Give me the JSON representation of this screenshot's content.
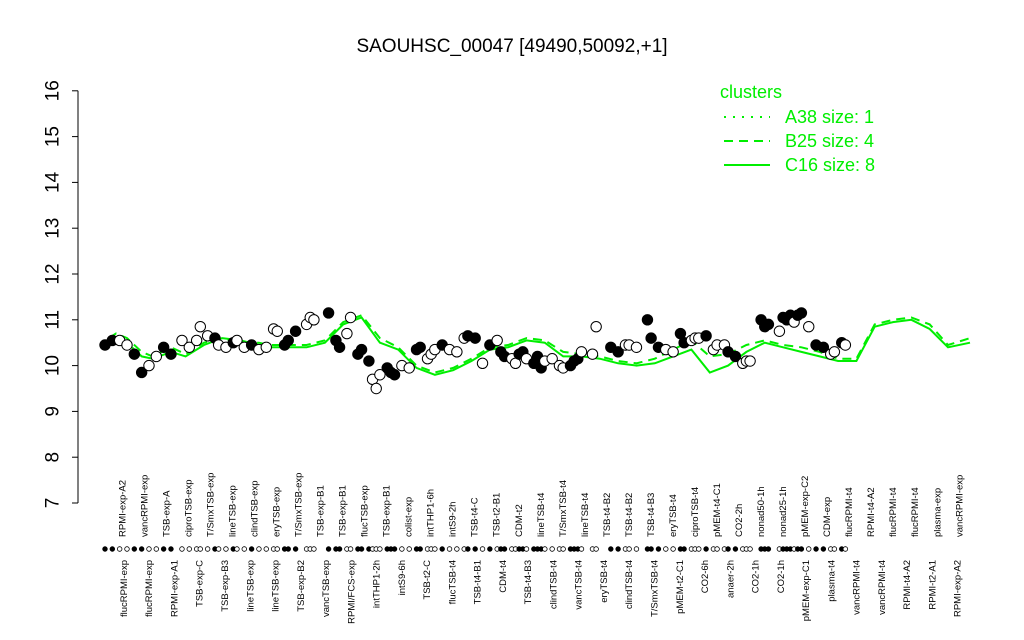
{
  "chart_data": {
    "type": "line",
    "title": "SAOUHSC_00047 [49490,50092,+1]",
    "xlabel": "",
    "ylabel": "",
    "ylim": [
      7,
      16
    ],
    "yticks": [
      "7",
      "8",
      "9",
      "10",
      "11",
      "12",
      "13",
      "14",
      "15",
      "16"
    ],
    "grid": false,
    "legend": {
      "title": "clusters",
      "placement": "top-right",
      "color": "#00ee00",
      "entries": [
        {
          "label": "A38 size: 1",
          "style": "dotted"
        },
        {
          "label": "B25 size: 4",
          "style": "dashed"
        },
        {
          "label": "C16 size: 8",
          "style": "solid"
        }
      ]
    },
    "top_labels": [
      "RPMI-exp-A2",
      "vancRPMI-exp",
      "TSB-exp-A",
      "ciproTSB-exp",
      "T/SmxTSB-exp",
      "lineTSB-exp",
      "clindTSB-exp",
      "eryTSB-exp",
      "T/SmxTSB-exp",
      "TSB-exp-B1",
      "TSB-exp-B1",
      "flucTSB-exp",
      "TSB-exp-B1",
      "colist-exp",
      "intTHP1-6h",
      "intS9-2h",
      "TSB-t4-C",
      "TSB-t2-B1",
      "CDM-t2",
      "lineTSB-t4",
      "T/SmxTSB-t4",
      "lineTSB-t4",
      "TSB-t4-B2",
      "TSB-t4-B2",
      "TSB-t4-B3",
      "eryTSB-t4",
      "ciproTSB-t4",
      "pMEM-t4-C1",
      "CO2-2h",
      "nonad50-1h",
      "nonad25-1h",
      "pMEM-exp-C2",
      "CDM-exp",
      "flucRPMI-t4",
      "RPMI-t4-A2",
      "flucRPMI-t4",
      "flucRPMI-t4",
      "plasma-exp",
      "vancRPMI-exp"
    ],
    "bottom_labels": [
      "flucRPMI-exp",
      "flucRPMI-exp",
      "RPMI-exp-A1",
      "TSB-exp-C",
      "TSB-exp-B3",
      "lineTSB-exp",
      "lineTSB-exp",
      "TSB-exp-B2",
      "vancTSB-exp",
      "RPMI/FCS-exp",
      "intTHP1-2h",
      "intS9-6h",
      "TSB-t2-C",
      "flucTSB-t4",
      "TSB-t4-B1",
      "CDM-t4",
      "TSB-t4-B3",
      "clindTSB-t4",
      "vancTSB-t4",
      "eryTSB-t4",
      "clindTSB-t4",
      "T/SmxTSB-t4",
      "pMEM-t2-C1",
      "CO2-6h",
      "anaer-2h",
      "CO2-1h",
      "CO2-1h",
      "pMEM-exp-C1",
      "plasma-t4",
      "vancRPMI-t4",
      "vancRPMI-t4",
      "RPMI-t4-A2",
      "RPMI-t2-A1",
      "RPMI-exp-A2"
    ],
    "series": [
      {
        "name": "C16 size: 8",
        "style": "solid",
        "x": [
          1,
          3,
          6,
          10,
          13,
          18,
          22,
          27,
          32,
          37,
          42,
          45,
          50,
          55,
          60,
          65,
          70,
          75,
          80,
          85,
          90,
          95,
          100,
          105,
          110,
          115,
          120,
          125,
          130,
          135,
          140,
          145,
          150,
          155,
          160,
          165,
          170,
          175,
          180,
          185,
          190,
          195,
          200,
          205,
          210,
          215,
          220,
          225,
          230,
          236
        ],
        "y": [
          10.55,
          10.6,
          10.5,
          10.2,
          10.15,
          10.3,
          10.2,
          10.45,
          10.6,
          10.55,
          10.45,
          10.4,
          10.4,
          10.4,
          10.5,
          10.9,
          11.05,
          10.5,
          10.35,
          9.95,
          9.8,
          9.9,
          10.1,
          10.35,
          10.4,
          10.55,
          10.5,
          10.2,
          10.2,
          10.15,
          10.05,
          10.0,
          10.05,
          10.2,
          10.35,
          9.85,
          10.0,
          10.3,
          10.5,
          10.4,
          10.3,
          10.2,
          10.1,
          10.1,
          10.85,
          10.95,
          11.0,
          10.8,
          10.4,
          10.5
        ]
      },
      {
        "name": "B25 size: 4",
        "style": "dashed",
        "x": [
          1,
          3,
          6,
          10,
          13,
          18,
          22,
          27,
          32,
          37,
          42,
          45,
          50,
          55,
          60,
          65,
          70,
          75,
          80,
          85,
          90,
          95,
          100,
          105,
          110,
          115,
          120,
          125,
          130,
          135,
          140,
          145,
          150,
          155,
          160,
          165,
          170,
          175,
          180,
          185,
          190,
          195,
          200,
          205,
          210,
          215,
          220,
          225,
          230,
          236
        ],
        "y": [
          10.6,
          10.7,
          10.6,
          10.3,
          10.2,
          10.4,
          10.25,
          10.5,
          10.6,
          10.5,
          10.5,
          10.45,
          10.45,
          10.45,
          10.55,
          10.95,
          11.1,
          10.6,
          10.4,
          10.0,
          9.85,
          9.95,
          10.15,
          10.4,
          10.45,
          10.6,
          10.55,
          10.3,
          10.25,
          10.2,
          10.1,
          10.05,
          10.15,
          10.35,
          10.55,
          10.2,
          10.25,
          10.45,
          10.55,
          10.45,
          10.4,
          10.3,
          10.15,
          10.15,
          10.9,
          11.0,
          11.05,
          10.9,
          10.45,
          10.6
        ]
      }
    ],
    "points": [
      {
        "x": 0,
        "y": 10.45,
        "filled": true
      },
      {
        "x": 2,
        "y": 10.55,
        "filled": true
      },
      {
        "x": 4,
        "y": 10.55,
        "filled": false
      },
      {
        "x": 6,
        "y": 10.45,
        "filled": false
      },
      {
        "x": 8,
        "y": 10.25,
        "filled": true
      },
      {
        "x": 10,
        "y": 9.85,
        "filled": true
      },
      {
        "x": 12,
        "y": 10.0,
        "filled": false
      },
      {
        "x": 14,
        "y": 10.2,
        "filled": false
      },
      {
        "x": 16,
        "y": 10.4,
        "filled": true
      },
      {
        "x": 18,
        "y": 10.25,
        "filled": true
      },
      {
        "x": 21,
        "y": 10.55,
        "filled": false
      },
      {
        "x": 23,
        "y": 10.4,
        "filled": false
      },
      {
        "x": 25,
        "y": 10.55,
        "filled": false
      },
      {
        "x": 26,
        "y": 10.85,
        "filled": false
      },
      {
        "x": 28,
        "y": 10.65,
        "filled": false
      },
      {
        "x": 30,
        "y": 10.6,
        "filled": true
      },
      {
        "x": 31,
        "y": 10.45,
        "filled": false
      },
      {
        "x": 33,
        "y": 10.4,
        "filled": false
      },
      {
        "x": 35,
        "y": 10.5,
        "filled": true
      },
      {
        "x": 36,
        "y": 10.55,
        "filled": false
      },
      {
        "x": 38,
        "y": 10.4,
        "filled": false
      },
      {
        "x": 40,
        "y": 10.45,
        "filled": true
      },
      {
        "x": 42,
        "y": 10.35,
        "filled": false
      },
      {
        "x": 44,
        "y": 10.4,
        "filled": false
      },
      {
        "x": 46,
        "y": 10.8,
        "filled": false
      },
      {
        "x": 47,
        "y": 10.75,
        "filled": false
      },
      {
        "x": 49,
        "y": 10.45,
        "filled": true
      },
      {
        "x": 50,
        "y": 10.55,
        "filled": true
      },
      {
        "x": 52,
        "y": 10.75,
        "filled": true
      },
      {
        "x": 55,
        "y": 10.9,
        "filled": false
      },
      {
        "x": 56,
        "y": 11.05,
        "filled": false
      },
      {
        "x": 57,
        "y": 11.0,
        "filled": false
      },
      {
        "x": 61,
        "y": 11.15,
        "filled": true
      },
      {
        "x": 63,
        "y": 10.55,
        "filled": true
      },
      {
        "x": 64,
        "y": 10.4,
        "filled": true
      },
      {
        "x": 66,
        "y": 10.7,
        "filled": false
      },
      {
        "x": 67,
        "y": 11.05,
        "filled": false
      },
      {
        "x": 69,
        "y": 10.25,
        "filled": true
      },
      {
        "x": 70,
        "y": 10.35,
        "filled": true
      },
      {
        "x": 72,
        "y": 10.1,
        "filled": true
      },
      {
        "x": 73,
        "y": 9.7,
        "filled": false
      },
      {
        "x": 74,
        "y": 9.5,
        "filled": false
      },
      {
        "x": 75,
        "y": 9.8,
        "filled": false
      },
      {
        "x": 77,
        "y": 9.95,
        "filled": true
      },
      {
        "x": 78,
        "y": 9.85,
        "filled": true
      },
      {
        "x": 79,
        "y": 9.8,
        "filled": true
      },
      {
        "x": 81,
        "y": 10.0,
        "filled": false
      },
      {
        "x": 83,
        "y": 9.95,
        "filled": false
      },
      {
        "x": 85,
        "y": 10.35,
        "filled": true
      },
      {
        "x": 86,
        "y": 10.4,
        "filled": true
      },
      {
        "x": 88,
        "y": 10.15,
        "filled": false
      },
      {
        "x": 89,
        "y": 10.25,
        "filled": false
      },
      {
        "x": 90,
        "y": 10.35,
        "filled": false
      },
      {
        "x": 92,
        "y": 10.45,
        "filled": true
      },
      {
        "x": 94,
        "y": 10.35,
        "filled": false
      },
      {
        "x": 96,
        "y": 10.3,
        "filled": false
      },
      {
        "x": 98,
        "y": 10.6,
        "filled": false
      },
      {
        "x": 99,
        "y": 10.65,
        "filled": true
      },
      {
        "x": 101,
        "y": 10.6,
        "filled": true
      },
      {
        "x": 103,
        "y": 10.05,
        "filled": false
      },
      {
        "x": 105,
        "y": 10.45,
        "filled": true
      },
      {
        "x": 107,
        "y": 10.55,
        "filled": false
      },
      {
        "x": 108,
        "y": 10.3,
        "filled": true
      },
      {
        "x": 109,
        "y": 10.2,
        "filled": true
      },
      {
        "x": 111,
        "y": 10.15,
        "filled": false
      },
      {
        "x": 112,
        "y": 10.05,
        "filled": false
      },
      {
        "x": 113,
        "y": 10.25,
        "filled": true
      },
      {
        "x": 114,
        "y": 10.3,
        "filled": true
      },
      {
        "x": 115,
        "y": 10.15,
        "filled": false
      },
      {
        "x": 117,
        "y": 10.05,
        "filled": true
      },
      {
        "x": 118,
        "y": 10.2,
        "filled": true
      },
      {
        "x": 119,
        "y": 9.95,
        "filled": true
      },
      {
        "x": 120,
        "y": 10.1,
        "filled": false
      },
      {
        "x": 122,
        "y": 10.15,
        "filled": false
      },
      {
        "x": 124,
        "y": 10.0,
        "filled": false
      },
      {
        "x": 125,
        "y": 9.95,
        "filled": false
      },
      {
        "x": 127,
        "y": 10.0,
        "filled": true
      },
      {
        "x": 128,
        "y": 10.1,
        "filled": true
      },
      {
        "x": 129,
        "y": 10.15,
        "filled": true
      },
      {
        "x": 130,
        "y": 10.3,
        "filled": false
      },
      {
        "x": 133,
        "y": 10.25,
        "filled": false
      },
      {
        "x": 134,
        "y": 10.85,
        "filled": false
      },
      {
        "x": 138,
        "y": 10.4,
        "filled": true
      },
      {
        "x": 140,
        "y": 10.3,
        "filled": true
      },
      {
        "x": 142,
        "y": 10.45,
        "filled": false
      },
      {
        "x": 143,
        "y": 10.45,
        "filled": false
      },
      {
        "x": 145,
        "y": 10.4,
        "filled": false
      },
      {
        "x": 148,
        "y": 11.0,
        "filled": true
      },
      {
        "x": 149,
        "y": 10.6,
        "filled": true
      },
      {
        "x": 151,
        "y": 10.4,
        "filled": true
      },
      {
        "x": 153,
        "y": 10.35,
        "filled": false
      },
      {
        "x": 155,
        "y": 10.3,
        "filled": false
      },
      {
        "x": 157,
        "y": 10.7,
        "filled": true
      },
      {
        "x": 158,
        "y": 10.5,
        "filled": true
      },
      {
        "x": 160,
        "y": 10.55,
        "filled": false
      },
      {
        "x": 161,
        "y": 10.6,
        "filled": false
      },
      {
        "x": 162,
        "y": 10.6,
        "filled": false
      },
      {
        "x": 164,
        "y": 10.65,
        "filled": true
      },
      {
        "x": 166,
        "y": 10.35,
        "filled": false
      },
      {
        "x": 167,
        "y": 10.45,
        "filled": false
      },
      {
        "x": 169,
        "y": 10.45,
        "filled": false
      },
      {
        "x": 170,
        "y": 10.3,
        "filled": true
      },
      {
        "x": 172,
        "y": 10.2,
        "filled": true
      },
      {
        "x": 174,
        "y": 10.05,
        "filled": false
      },
      {
        "x": 175,
        "y": 10.1,
        "filled": false
      },
      {
        "x": 176,
        "y": 10.1,
        "filled": false
      },
      {
        "x": 179,
        "y": 11.0,
        "filled": true
      },
      {
        "x": 180,
        "y": 10.85,
        "filled": true
      },
      {
        "x": 181,
        "y": 10.9,
        "filled": true
      },
      {
        "x": 184,
        "y": 10.75,
        "filled": false
      },
      {
        "x": 185,
        "y": 11.05,
        "filled": true
      },
      {
        "x": 186,
        "y": 11.0,
        "filled": true
      },
      {
        "x": 187,
        "y": 11.1,
        "filled": true
      },
      {
        "x": 188,
        "y": 10.95,
        "filled": false
      },
      {
        "x": 189,
        "y": 11.1,
        "filled": true
      },
      {
        "x": 190,
        "y": 11.15,
        "filled": true
      },
      {
        "x": 192,
        "y": 10.85,
        "filled": false
      },
      {
        "x": 194,
        "y": 10.45,
        "filled": true
      },
      {
        "x": 196,
        "y": 10.4,
        "filled": true
      },
      {
        "x": 198,
        "y": 10.25,
        "filled": false
      },
      {
        "x": 199,
        "y": 10.3,
        "filled": false
      },
      {
        "x": 201,
        "y": 10.5,
        "filled": true
      },
      {
        "x": 202,
        "y": 10.45,
        "filled": false
      }
    ]
  }
}
